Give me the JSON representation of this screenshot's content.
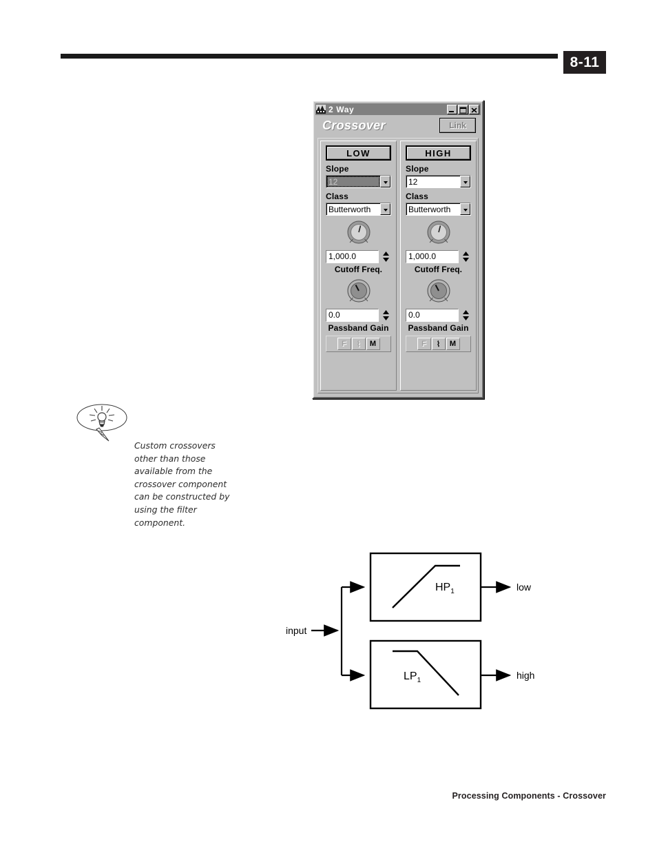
{
  "page": {
    "number": "8-11",
    "footer": "Processing Components - Crossover"
  },
  "tip": {
    "icon": "lightbulb-icon",
    "text": "Custom crossovers other than those available from the crossover component can be constructed by using the filter component."
  },
  "dialog": {
    "title": "2 Way",
    "title_icon": "app-icon",
    "window_buttons": [
      {
        "name": "minimize",
        "glyph": "_"
      },
      {
        "name": "maximize",
        "glyph": "□"
      },
      {
        "name": "close",
        "glyph": "✕"
      }
    ],
    "heading": "Crossover",
    "link_label": "Link",
    "link_enabled": false,
    "channels": [
      {
        "id": "low",
        "button_label": "LOW",
        "slope_label": "Slope",
        "slope_value": "12",
        "slope_focused": true,
        "class_label": "Class",
        "class_value": "Butterworth",
        "cutoff_value": "1,000.0",
        "cutoff_label": "Cutoff Freq.",
        "gain_value": "0.0",
        "gain_label": "Passband Gain",
        "mode_buttons": [
          {
            "name": "flat",
            "label": "F",
            "dim": true
          },
          {
            "name": "slope",
            "label": "⌇",
            "dim": true
          },
          {
            "name": "mute",
            "label": "M",
            "dim": false
          }
        ]
      },
      {
        "id": "high",
        "button_label": "HIGH",
        "slope_label": "Slope",
        "slope_value": "12",
        "slope_focused": false,
        "class_label": "Class",
        "class_value": "Butterworth",
        "cutoff_value": "1,000.0",
        "cutoff_label": "Cutoff Freq.",
        "gain_value": "0.0",
        "gain_label": "Passband Gain",
        "mode_buttons": [
          {
            "name": "flat",
            "label": "F",
            "dim": true
          },
          {
            "name": "slope",
            "label": "⌇",
            "dim": false
          },
          {
            "name": "mute",
            "label": "M",
            "dim": false
          }
        ]
      }
    ]
  },
  "diagram": {
    "input_label": "input",
    "blocks": [
      {
        "id": "hp",
        "label": "HP",
        "subscript": "1",
        "response": "highpass",
        "output_label": "low"
      },
      {
        "id": "lp",
        "label": "LP",
        "subscript": "1",
        "response": "lowpass",
        "output_label": "high"
      }
    ]
  },
  "colors": {
    "window_face": "#c0c0c0",
    "titlebar": "#808080",
    "ink": "#231f20",
    "field_bg": "#ffffff"
  }
}
